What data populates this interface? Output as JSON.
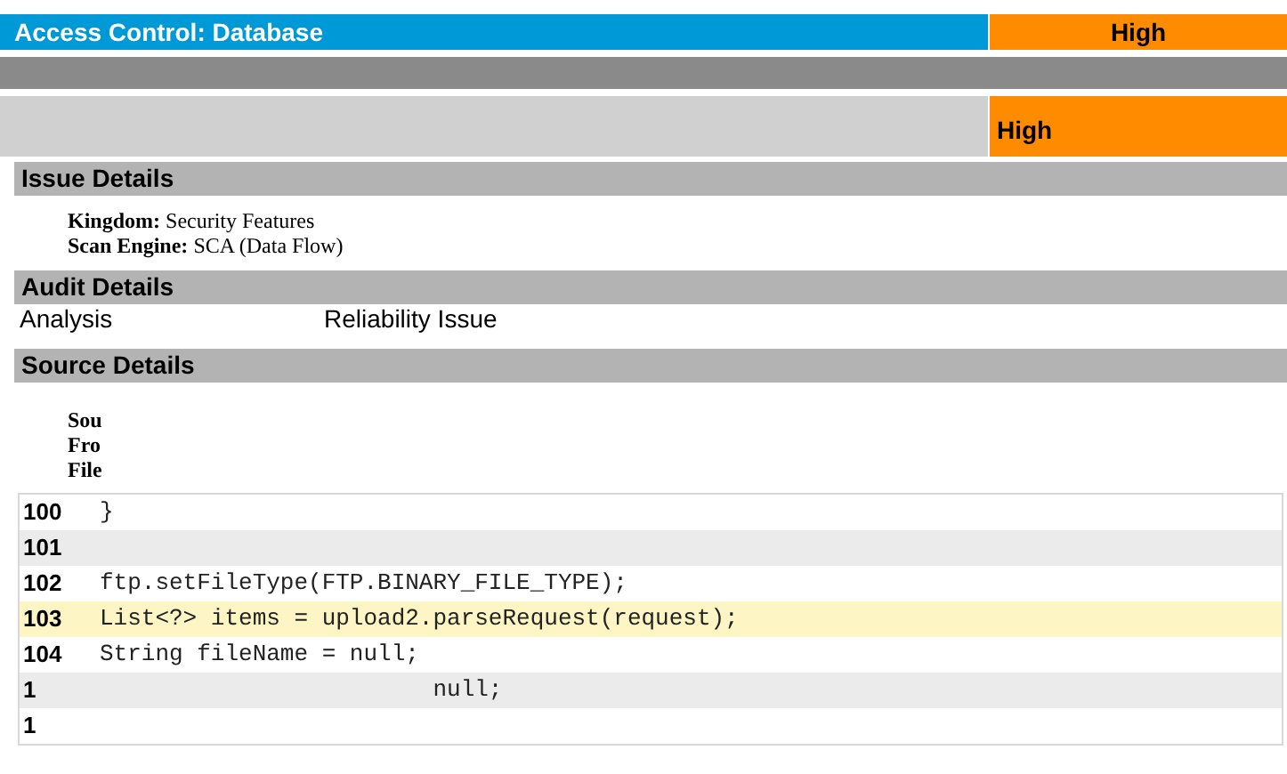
{
  "header": {
    "title": "Access Control: Database",
    "priority": "High"
  },
  "summary": {
    "priority": "High"
  },
  "issue_details": {
    "title": "Issue Details",
    "fields": [
      {
        "label": "Kingdom:",
        "value": "Security Features"
      },
      {
        "label": "Scan Engine:",
        "value": "SCA (Data Flow)"
      }
    ]
  },
  "audit_details": {
    "title": "Audit Details",
    "rows": [
      {
        "label": "Analysis",
        "value": "Reliability Issue"
      }
    ]
  },
  "source_details": {
    "title": "Source Details",
    "labels": [
      "Sou",
      "Fro",
      "File"
    ]
  },
  "code": [
    {
      "number": "100",
      "text": "}",
      "selected": false
    },
    {
      "number": "101",
      "selected": false
    },
    {
      "number": "102",
      "text": "ftp.setFileType(FTP.BINARY_FILE_TYPE);",
      "selected": false
    },
    {
      "number": "103",
      "text": "List<?> items = upload2.parseRequest(request);",
      "selected": true
    },
    {
      "number": "104",
      "text": "String fileName = null;",
      "selected": false
    },
    {
      "number": "1",
      "text": "                        null;",
      "selected": false
    },
    {
      "number": "1",
      "selected": false
    }
  ]
}
